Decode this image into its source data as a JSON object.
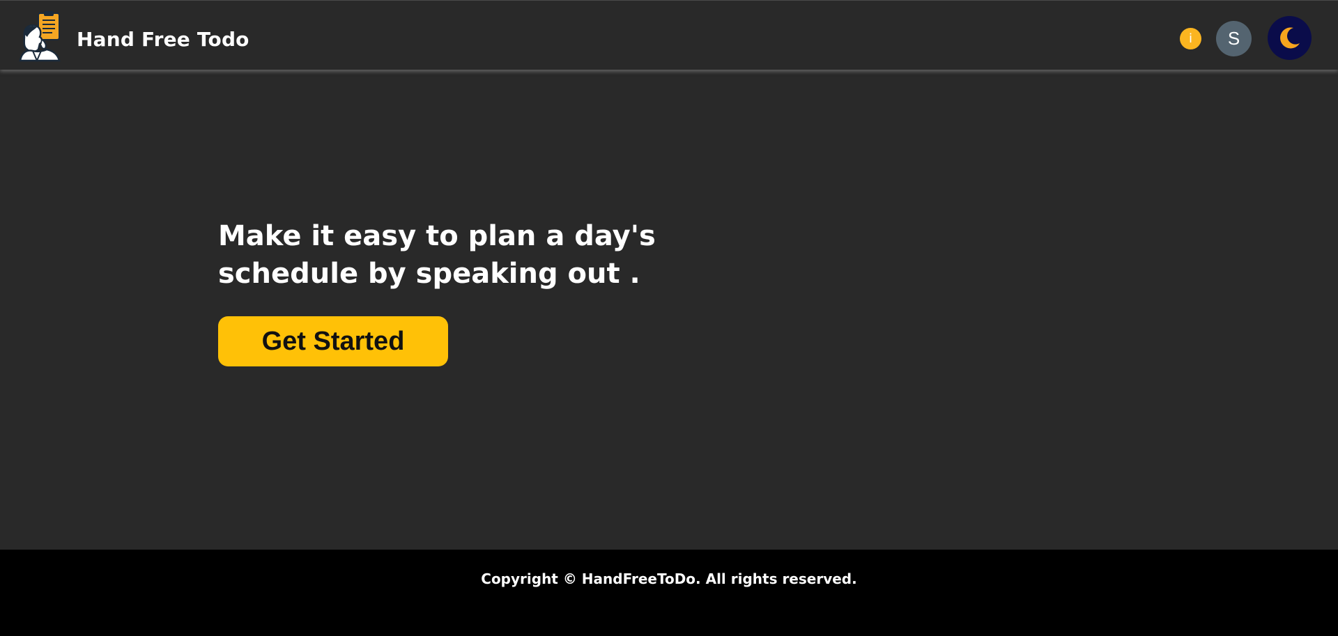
{
  "header": {
    "brand_title": "Hand Free Todo",
    "info_label": "i",
    "avatar_initial": "S",
    "logo_icon": "todo-person-clipboard-icon",
    "theme_icon": "crescent-moon-icon"
  },
  "hero": {
    "headline": "Make it easy to plan a day's schedule by speaking out .",
    "cta_label": "Get Started"
  },
  "footer": {
    "copyright": "Copyright © HandFreeToDo. All rights reserved."
  },
  "colors": {
    "background": "#292929",
    "accent": "#ffc107",
    "info": "#fbb520",
    "avatar": "#546470",
    "theme_toggle": "#0a0c4a",
    "footer": "#000000"
  }
}
